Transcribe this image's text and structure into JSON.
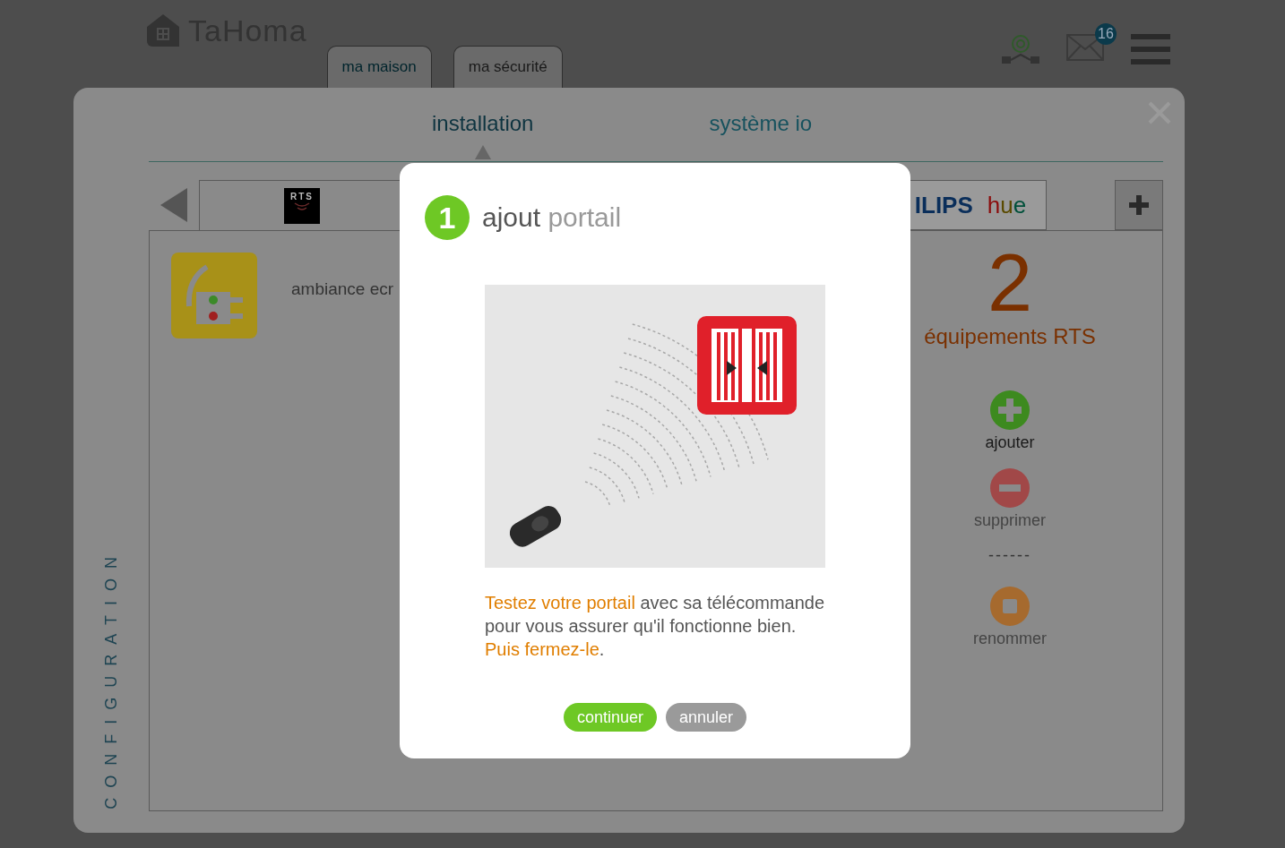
{
  "header": {
    "logo": "TaHoma",
    "tabs": [
      {
        "label": "ma maison",
        "selected": true
      },
      {
        "label": "ma sécurité",
        "selected": false
      }
    ],
    "mail_count": "16"
  },
  "panel": {
    "side_label": "CONFIGURATION",
    "tabs": [
      {
        "label": "installation",
        "selected": true
      },
      {
        "label": "système io",
        "selected": false
      }
    ],
    "protocols": [
      {
        "kind": "rts",
        "logo": "RTS",
        "selected": true
      },
      {
        "kind": "hue",
        "logo": "ILIPS",
        "logo_extra": "hue",
        "selected": false
      }
    ],
    "devices": [
      {
        "label": "ambiance ecr"
      }
    ],
    "summary": {
      "count": "2",
      "label": "équipements RTS"
    },
    "actions": [
      {
        "kind": "add",
        "label": "ajouter",
        "disabled": false
      },
      {
        "kind": "remove",
        "label": "supprimer",
        "disabled": true
      },
      {
        "kind": "separator",
        "label": "------",
        "disabled": true
      },
      {
        "kind": "rename",
        "label": "renommer",
        "disabled": true
      }
    ]
  },
  "dialog": {
    "step": "1",
    "title": [
      {
        "text": "ajout",
        "muted": false
      },
      {
        "text": "portail",
        "muted": true
      }
    ],
    "message": [
      {
        "text": "Testez votre portail",
        "highlight": true
      },
      {
        "text": " avec sa télécommande pour vous assurer qu'il fonctionne bien. ",
        "highlight": false
      },
      {
        "text": "Puis fermez-le",
        "highlight": true
      },
      {
        "text": ".",
        "highlight": false
      }
    ],
    "buttons": [
      {
        "kind": "primary",
        "label": "continuer"
      },
      {
        "kind": "secondary",
        "label": "annuler"
      }
    ]
  }
}
